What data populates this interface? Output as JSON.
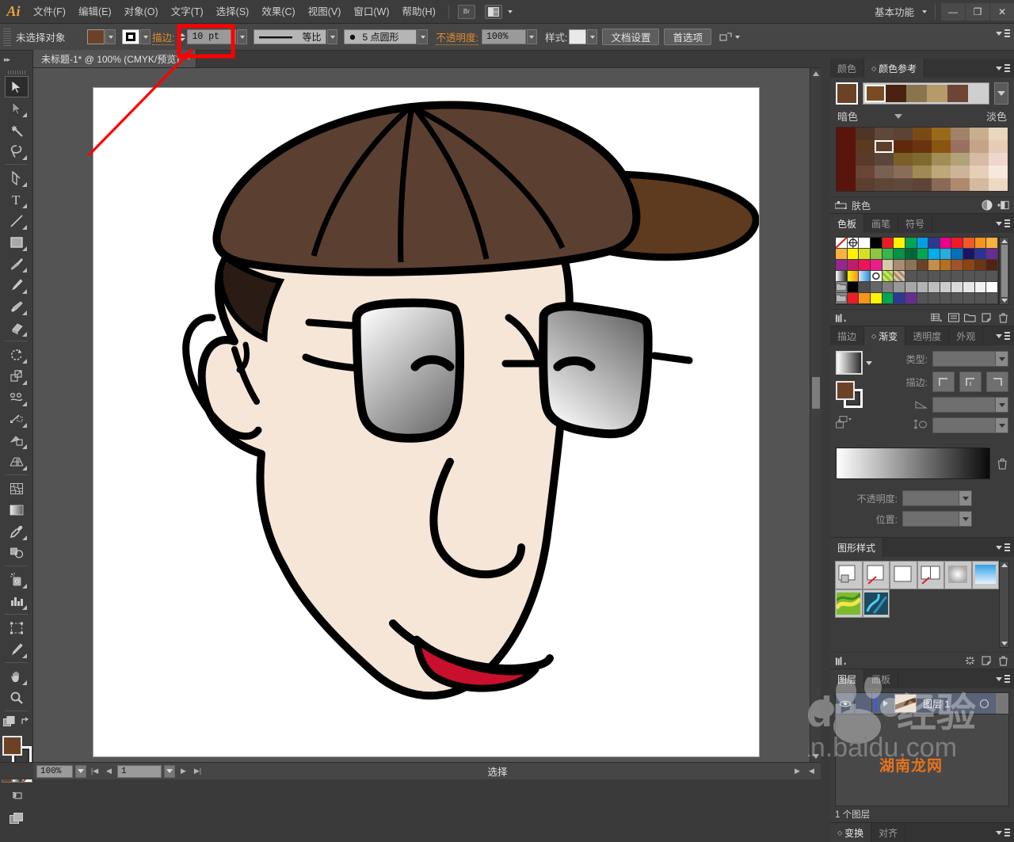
{
  "app": {
    "logo": "Ai",
    "workspace": "基本功能",
    "window_buttons": {
      "minimize": "—",
      "restore": "❐",
      "close": "✕"
    }
  },
  "menubar": {
    "items": [
      "文件(F)",
      "编辑(E)",
      "对象(O)",
      "文字(T)",
      "选择(S)",
      "效果(C)",
      "视图(V)",
      "窗口(W)",
      "帮助(H)"
    ],
    "bridge_icon": "Br",
    "arrange_icon": "arrange-documents-icon"
  },
  "control_bar": {
    "status": "未选择对象",
    "fill_label": "fill-swatch",
    "fill_color": "#6B4226",
    "stroke_label": "stroke-swatch",
    "stroke_label_text": "描边:",
    "stroke_weight": "10 pt",
    "stroke_profile": "等比",
    "brush_definition": "5 点圆形",
    "opacity_label": "不透明度:",
    "opacity_value": "100%",
    "style_label": "样式:",
    "doc_setup": "文档设置",
    "preferences": "首选项"
  },
  "document_tab": {
    "title": "未标题-1* @ 100% (CMYK/预览)",
    "close": "×"
  },
  "toolbar": {
    "tools": [
      {
        "name": "selection-tool",
        "label": "选择工具",
        "selected": true
      },
      {
        "name": "direct-selection-tool",
        "label": "直接选择工具"
      },
      {
        "name": "magic-wand-tool",
        "label": "魔棒工具"
      },
      {
        "name": "lasso-tool",
        "label": "套索工具"
      },
      {
        "name": "pen-tool",
        "label": "钢笔工具"
      },
      {
        "name": "type-tool",
        "label": "文字工具"
      },
      {
        "name": "line-segment-tool",
        "label": "直线段工具"
      },
      {
        "name": "rectangle-tool",
        "label": "矩形工具"
      },
      {
        "name": "paintbrush-tool",
        "label": "画笔工具"
      },
      {
        "name": "pencil-tool",
        "label": "铅笔工具"
      },
      {
        "name": "blob-brush-tool",
        "label": "斑点画笔工具"
      },
      {
        "name": "eraser-tool",
        "label": "橡皮擦工具"
      },
      {
        "name": "rotate-tool",
        "label": "旋转工具"
      },
      {
        "name": "scale-tool",
        "label": "比例缩放工具"
      },
      {
        "name": "width-tool",
        "label": "宽度工具"
      },
      {
        "name": "free-transform-tool",
        "label": "自由变换工具"
      },
      {
        "name": "shape-builder-tool",
        "label": "形状生成器工具"
      },
      {
        "name": "perspective-grid-tool",
        "label": "透视网格工具"
      },
      {
        "name": "mesh-tool",
        "label": "网格工具"
      },
      {
        "name": "gradient-tool",
        "label": "渐变工具"
      },
      {
        "name": "eyedropper-tool",
        "label": "吸管工具"
      },
      {
        "name": "blend-tool",
        "label": "混合工具"
      },
      {
        "name": "symbol-sprayer-tool",
        "label": "符号喷枪工具"
      },
      {
        "name": "column-graph-tool",
        "label": "柱形图工具"
      },
      {
        "name": "artboard-tool",
        "label": "画板工具"
      },
      {
        "name": "slice-tool",
        "label": "切片工具"
      },
      {
        "name": "hand-tool",
        "label": "抓手工具"
      },
      {
        "name": "zoom-tool",
        "label": "缩放工具"
      }
    ],
    "fill_color": "#6B4226",
    "stroke_color": "#FFFFFF"
  },
  "artwork": {
    "description": "戴棕色鸭舌帽和墨镜的卡通侧脸",
    "cap_color": "#5B4031",
    "cap_brim_color": "#5E3A1E",
    "skin_color": "#F6E6D8",
    "lens_gradient_from": "#F2F2F2",
    "lens_gradient_to": "#6E6E6E",
    "lip_color": "#C8102E",
    "outline_color": "#000000"
  },
  "annotation": {
    "highlight_target": "10 pt",
    "highlight_color": "#FF0000",
    "arrow": "red-arrow-pointing-to-stroke-weight"
  },
  "panels": {
    "color_guide": {
      "tabs": [
        "颜色",
        "颜色参考"
      ],
      "active_tab": "颜色参考",
      "base_color": "#6B4226",
      "harmony_colors": [
        "#7A4A22",
        "#4A2310",
        "#8A7450",
        "#B79A6A",
        "#6E4534"
      ],
      "left_label": "暗色",
      "right_label": "淡色",
      "footer_label": "肤色",
      "grid": [
        [
          "#5A140C",
          "#4F3526",
          "#5E483A",
          "#5B4434",
          "#7A4A14",
          "#9A6A1C",
          "#A2816A",
          "#C8AE8E",
          "#EBD6BE"
        ],
        [
          "#5A140C",
          "#5C3A22",
          "#5E402A",
          "#5E2A0C",
          "#6A3310",
          "#8A5412",
          "#9A7060",
          "#C4A388",
          "#E6CCB4"
        ],
        [
          "#5A140C",
          "#5A3A2A",
          "#5C463C",
          "#7A6026",
          "#7E6A2E",
          "#A08E56",
          "#B0A277",
          "#D6BCA4",
          "#EFD6CE"
        ],
        [
          "#5A140C",
          "#6A4436",
          "#7A6050",
          "#8A6C5C",
          "#A08A52",
          "#BCA878",
          "#CCB49A",
          "#E6CEB8",
          "#F6E8DC"
        ],
        [
          "#5A140C",
          "#5C3E2E",
          "#5E4636",
          "#60483A",
          "#5E4436",
          "#8A6A56",
          "#B08A6E",
          "#D4BA9E",
          "#EED8C2"
        ]
      ],
      "selected_cell": {
        "row": 1,
        "col": 2
      }
    },
    "swatches": {
      "tabs": [
        "色板",
        "画笔",
        "符号"
      ],
      "active_tab": "色板",
      "rows": [
        [
          "none",
          "registration",
          "#FFFFFF",
          "#000000",
          "#ED1C24",
          "#FFF200",
          "#00A651",
          "#00A0E3",
          "#2B3990",
          "#EC008C",
          "#ED1C24",
          "#F1592A",
          "#F7941D",
          "#FBB040"
        ],
        [
          "#FBB040",
          "#FFF200",
          "#D7DF23",
          "#8DC63F",
          "#39B54A",
          "#009444",
          "#006838",
          "#00A651",
          "#00AEEF",
          "#29ABE2",
          "#0071BC",
          "#1B1464",
          "#2E3192",
          "#662D91"
        ],
        [
          "#92278F",
          "#BE1E68",
          "#ED145B",
          "#EC1C8C",
          "#D9C9A8",
          "#A98B72",
          "#8A7358",
          "#6B4226",
          "#C68E4C",
          "#B5701C",
          "#A0522D",
          "#8B4513",
          "#6E3512",
          "#4E2410"
        ],
        [
          "grad-gray",
          "grad-orange",
          "grad-blue",
          "pattern-dot",
          "pattern-green",
          "pattern-brown"
        ],
        [
          "folder",
          "#000000",
          "#4D4D4D",
          "#666666",
          "#808080",
          "#999999",
          "#A6A6A6",
          "#B3B3B3",
          "#BFBFBF",
          "#CCCCCC",
          "#D9D9D9",
          "#E6E6E6",
          "#F2F2F2",
          "#FFFFFF"
        ],
        [
          "folder",
          "#ED1C24",
          "#F7941D",
          "#FFF200",
          "#00A651",
          "#2B3990",
          "#662D91"
        ]
      ]
    },
    "gradient": {
      "tabs": [
        "描边",
        "渐变",
        "透明度",
        "外观"
      ],
      "active_tab": "渐变",
      "type_label": "类型:",
      "stroke_label": "描边:",
      "angle_label": "angle-field",
      "aspect_label": "aspect-ratio-field",
      "opacity_label": "不透明度:",
      "location_label": "位置:",
      "gradient_from": "#FFFFFF",
      "gradient_to": "#0A0A0A",
      "fill_color": "#6B4226"
    },
    "graphic_styles": {
      "title": "图形样式",
      "cells": [
        "drop-shadow-style",
        "white-no-stroke-style",
        "plain-white-style",
        "split-no-fill-style",
        "gray-gradient-style",
        "blue-gradient-style",
        "green-swirl-style",
        "blue-swirl-style"
      ]
    },
    "layers": {
      "tabs": [
        "图层",
        "画板"
      ],
      "active_tab": "图层",
      "layer_name": "图层 1",
      "count_text": "1 个图层",
      "visible": true,
      "locked": false
    },
    "transform": {
      "tabs": [
        "变换",
        "对齐"
      ],
      "active_tab": "变换"
    }
  },
  "status_bar": {
    "zoom": "100%",
    "page": "1",
    "mode": "选择"
  },
  "watermarks": {
    "baidu_text": "经验",
    "baidu_sub": "jingyan.baidu.com",
    "baidu_brand": "Bai",
    "baidu_du": "du",
    "hunan": "湖南龙网"
  }
}
